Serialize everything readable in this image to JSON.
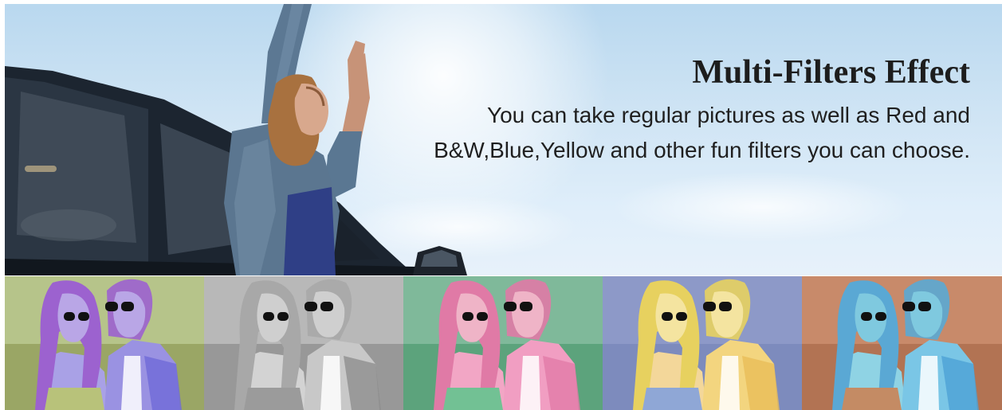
{
  "hero": {
    "title": "Multi-Filters Effect",
    "description": "You can take regular pictures as well as Red and B&W,Blue,Yellow and other fun filters you can choose.",
    "sky_color": "#cfe4f4"
  },
  "filters": [
    {
      "id": "purple",
      "bg": "#b6c48a",
      "ground": "#8e9a55",
      "skin": "#b9a6e6",
      "hair": "#9c62cf",
      "top": "#a9a1e6",
      "overall": "#b8c27a",
      "shirt": "#9a92e2",
      "shirt2": "#6f6ad8"
    },
    {
      "id": "bw",
      "bg": "#b8b8b8",
      "ground": "#8a8a8a",
      "skin": "#cfcfcf",
      "hair": "#a8a8a8",
      "top": "#d3d3d3",
      "overall": "#9b9b9b",
      "shirt": "#c8c8c8",
      "shirt2": "#8e8e8e"
    },
    {
      "id": "pink-green",
      "bg": "#7fb99a",
      "ground": "#4d9a6f",
      "skin": "#efb4c7",
      "hair": "#e07aa6",
      "top": "#f2a6c5",
      "overall": "#72c194",
      "shirt": "#f19ec2",
      "shirt2": "#e27aa8"
    },
    {
      "id": "yellow",
      "bg": "#8d99c8",
      "ground": "#7685b8",
      "skin": "#f4e4a0",
      "hair": "#e7d15f",
      "top": "#f3d79a",
      "overall": "#8fa7d6",
      "shirt": "#f3d57f",
      "shirt2": "#e9bd59"
    },
    {
      "id": "blue",
      "bg": "#c88a6a",
      "ground": "#a86a4a",
      "skin": "#7fc9df",
      "hair": "#5aa8d4",
      "top": "#8fd3e4",
      "overall": "#c48b64",
      "shirt": "#7ac6e6",
      "shirt2": "#4ea1d6"
    }
  ]
}
